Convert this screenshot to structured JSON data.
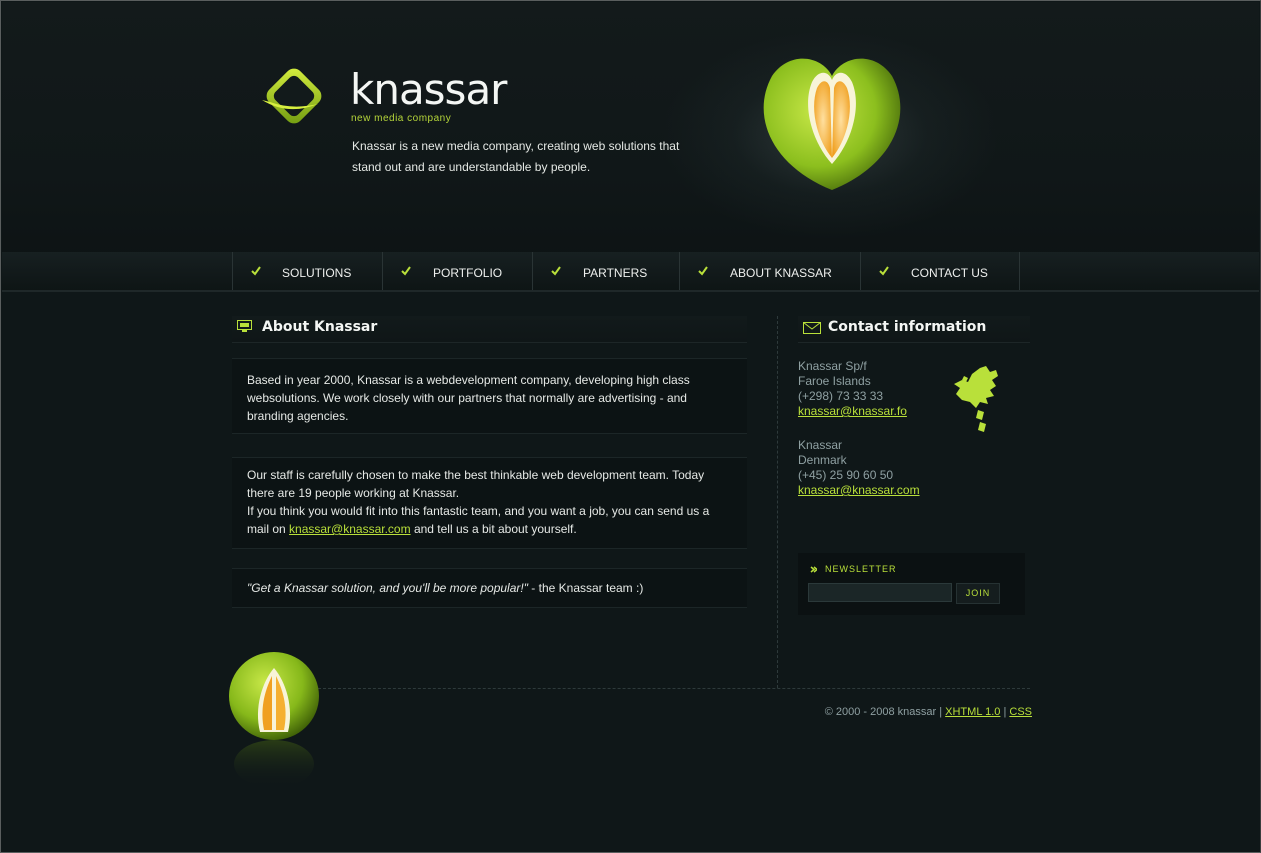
{
  "brand": {
    "name": "knassar",
    "subtitle": "new media company",
    "tagline_line1": "Knassar is a new media company, creating web solutions that",
    "tagline_line2": "stand out and are understandable by people.",
    "accent_color": "#b9e03a"
  },
  "nav": {
    "items": [
      {
        "label": "SOLUTIONS",
        "icon": "check-icon"
      },
      {
        "label": "PORTFOLIO",
        "icon": "check-icon"
      },
      {
        "label": "PARTNERS",
        "icon": "check-icon"
      },
      {
        "label": "ABOUT KNASSAR",
        "icon": "check-icon"
      },
      {
        "label": "CONTACT US",
        "icon": "check-icon"
      }
    ]
  },
  "about": {
    "title": "About Knassar",
    "icon": "monitor-icon",
    "para1": "Based in year 2000, Knassar is a webdevelopment company, developing high class websolutions. We work closely with our partners that normally are advertising - and branding agencies.",
    "para2_line1": "Our staff is carefully chosen to make the best thinkable web development team. Today there are 19 people working at Knassar.",
    "para2_line2_start": "If you think you would fit into this fantastic team, and you want a job, you can send us a mail on",
    "para2_email": "knassar@knassar.com",
    "para2_line2_end": "and tell us a bit about yourself.",
    "quote": "\"Get a Knassar solution, and you'll be more popular!\"",
    "quote_suffix": " - the Knassar team :)"
  },
  "contact": {
    "title": "Contact information",
    "icon": "envelope-icon",
    "office1": {
      "name": "Knassar Sp/f",
      "location": "Faroe Islands",
      "phone": "(+298) 73 33 33",
      "email": "knassar@knassar.fo"
    },
    "office2": {
      "name": "Knassar",
      "location": "Denmark",
      "phone": "(+45) 25 90 60 50",
      "email": "knassar@knassar.com"
    }
  },
  "newsletter": {
    "label": "NEWSLETTER",
    "input_value": "",
    "button_label": "JOIN"
  },
  "footer": {
    "copyright": "© 2000 - 2008 knassar |",
    "xhtml_link": "XHTML 1.0",
    "separator": "|",
    "css_link": "CSS"
  }
}
